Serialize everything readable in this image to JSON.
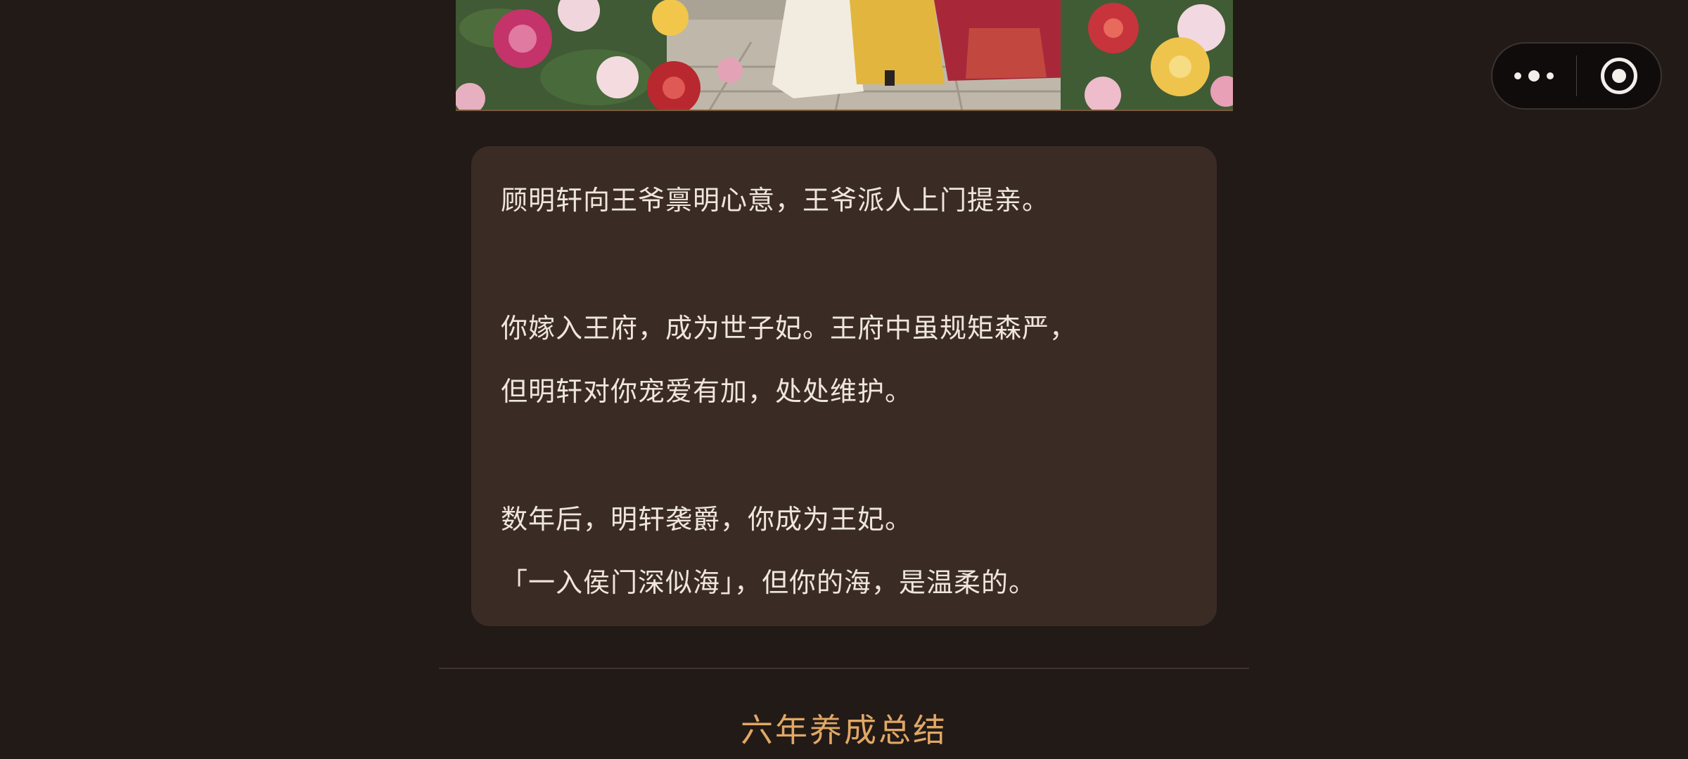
{
  "scene": {
    "icon": "scene-illustration"
  },
  "capsule": {
    "more_icon": "more-dots-icon",
    "close_icon": "target-close-icon"
  },
  "story": {
    "lines": [
      "顾明轩向王爷禀明心意，王爷派人上门提亲。",
      "你嫁入王府，成为世子妃。王府中虽规矩森严，",
      "但明轩对你宠爱有加，处处维护。",
      "数年后，明轩袭爵，你成为王妃。",
      "「一入侯门深似海」，但你的海，是温柔的。"
    ]
  },
  "summary": {
    "title": "六年养成总结"
  },
  "colors": {
    "background": "#221a17",
    "card": "#3a2c25",
    "text": "#efe6dc",
    "accent": "#e0a865"
  }
}
